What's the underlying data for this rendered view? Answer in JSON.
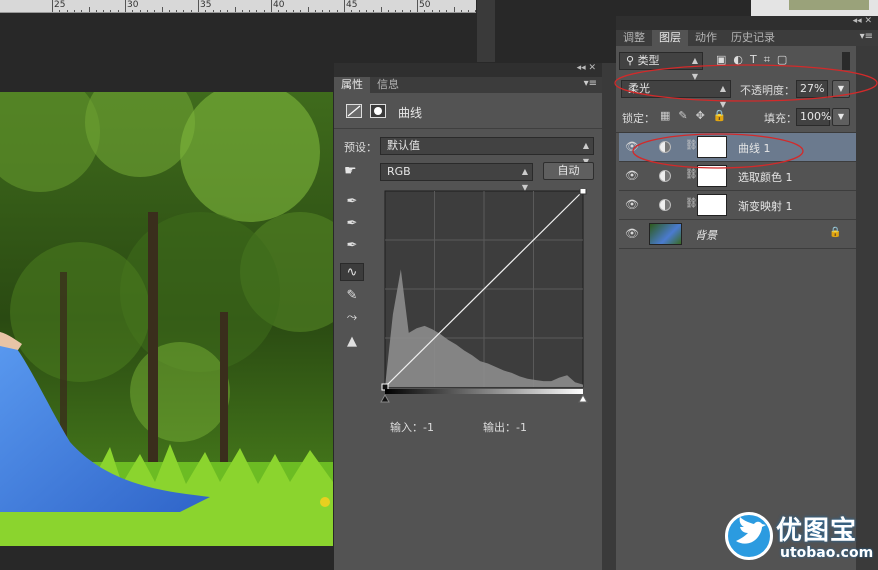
{
  "ruler": {
    "ticks": [
      "25",
      "30",
      "35",
      "40",
      "45",
      "50"
    ]
  },
  "properties_panel": {
    "tabs": [
      "属性",
      "信息"
    ],
    "title": "曲线",
    "preset_label": "预设：",
    "preset_value": "默认值",
    "channel_value": "RGB",
    "auto_button": "自动",
    "input_label": "输入：-1",
    "output_label": "输出：-1"
  },
  "layers_panel": {
    "tabs": [
      "调整",
      "图层",
      "动作",
      "历史记录"
    ],
    "filter_label": "类型",
    "blend_mode": "柔光",
    "opacity_label": "不透明度：",
    "opacity_value": "27%",
    "lock_label": "锁定：",
    "fill_label": "填充：",
    "fill_value": "100%",
    "layers": [
      {
        "name": "曲线 1",
        "selected": true
      },
      {
        "name": "选取颜色 1",
        "selected": false
      },
      {
        "name": "渐变映射 1",
        "selected": false
      },
      {
        "name": "背景",
        "selected": false
      }
    ]
  },
  "watermark": {
    "brand": "优图宝",
    "url": "utobao.com"
  },
  "colors": {
    "annotation_red": "#d22a2a",
    "selected_layer": "#6b7a8e",
    "panel_bg": "#535353"
  },
  "chart_data": {
    "type": "area",
    "x": [
      0,
      4,
      8,
      12,
      16,
      20,
      24,
      28,
      32,
      36,
      40,
      44,
      48,
      52,
      56,
      60,
      64,
      68,
      72,
      76,
      80,
      84,
      88,
      92,
      96,
      100
    ],
    "values": [
      0,
      62,
      100,
      46,
      50,
      52,
      49,
      45,
      40,
      36,
      31,
      27,
      22,
      20,
      17,
      14,
      12,
      9,
      7,
      6,
      5,
      5,
      8,
      10,
      4,
      2
    ],
    "ylim": [
      0,
      100
    ],
    "curve": [
      [
        0,
        0
      ],
      [
        255,
        255
      ]
    ]
  }
}
